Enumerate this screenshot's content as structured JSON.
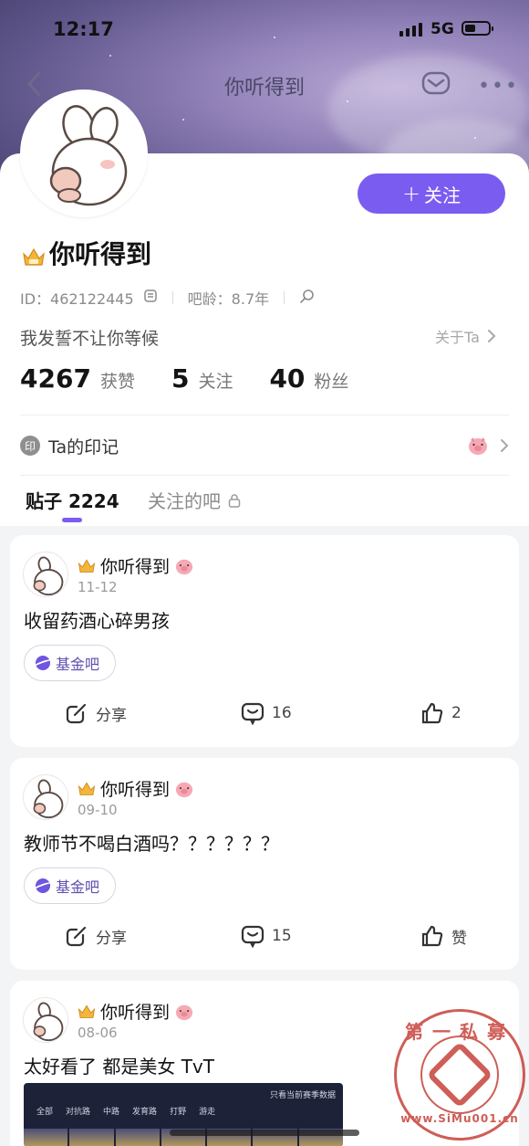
{
  "status_bar": {
    "time": "12:17",
    "network": "5G"
  },
  "nav": {
    "title": "你听得到"
  },
  "profile": {
    "follow_label": "关注",
    "username": "你听得到",
    "id_text": "ID：462122445",
    "bar_age": "吧龄：8.7年",
    "signature": "我发誓不让你等候",
    "about_label": "关于Ta",
    "stats": [
      {
        "value": "4267",
        "label": "获赞"
      },
      {
        "value": "5",
        "label": "关注"
      },
      {
        "value": "40",
        "label": "粉丝"
      }
    ],
    "mark_badge": "印",
    "mark_label": "Ta的印记"
  },
  "tabs": {
    "posts_label": "贴子 2224",
    "followed_bars_label": "关注的吧"
  },
  "posts": [
    {
      "author": "你听得到",
      "date": "11-12",
      "text": "收留药酒心碎男孩",
      "forum": "基金吧",
      "share": "分享",
      "comments": "16",
      "likes": "2"
    },
    {
      "author": "你听得到",
      "date": "09-10",
      "text": "教师节不喝白酒吗？？？？？？",
      "forum": "基金吧",
      "share": "分享",
      "comments": "15",
      "likes": "赞"
    },
    {
      "author": "你听得到",
      "date": "08-06",
      "text": "太好看了 都是美女 TvT",
      "thumb": {
        "note": "只看当前赛季数据",
        "tabs": [
          "全部",
          "对抗路",
          "中路",
          "发育路",
          "打野",
          "游走"
        ]
      }
    }
  ],
  "watermark": {
    "top": "第一私募",
    "bottom": "www.SiMu001.cn"
  },
  "colors": {
    "accent": "#7b5cf0",
    "seal": "#c2362e"
  }
}
